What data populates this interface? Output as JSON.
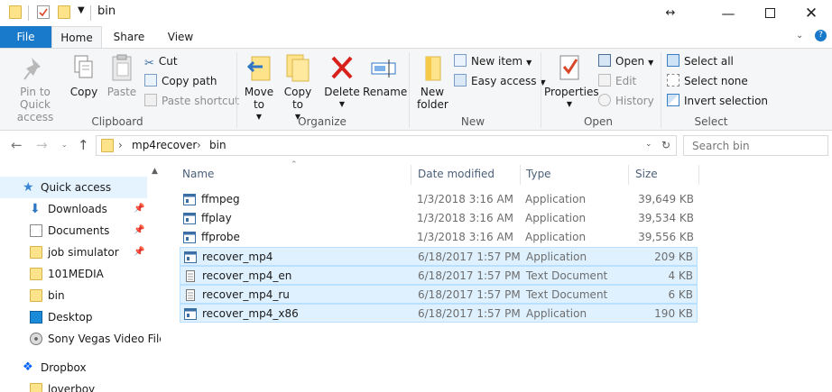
{
  "window": {
    "title": "bin"
  },
  "tabs": [
    "File",
    "Home",
    "Share",
    "View"
  ],
  "ribbon": {
    "clipboard": {
      "label": "Clipboard",
      "pin_to_quick_access": "Pin to Quick access",
      "copy": "Copy",
      "paste": "Paste",
      "cut": "Cut",
      "copy_path": "Copy path",
      "paste_shortcut": "Paste shortcut"
    },
    "organize": {
      "label": "Organize",
      "move_to": "Move to",
      "copy_to": "Copy to",
      "delete": "Delete",
      "rename": "Rename"
    },
    "new": {
      "label": "New",
      "new_folder": "New folder",
      "new_item": "New item",
      "easy_access": "Easy access"
    },
    "open": {
      "label": "Open",
      "properties": "Properties",
      "open": "Open",
      "edit": "Edit",
      "history": "History"
    },
    "select": {
      "label": "Select",
      "select_all": "Select all",
      "select_none": "Select none",
      "invert_selection": "Invert selection"
    }
  },
  "address": {
    "crumbs": [
      "mp4recover",
      "bin"
    ],
    "search_placeholder": "Search bin"
  },
  "nav_pane": [
    {
      "label": "Quick access",
      "icon": "star-icon",
      "selected": true
    },
    {
      "label": "Downloads",
      "icon": "download-icon",
      "pinned": true
    },
    {
      "label": "Documents",
      "icon": "documents-icon",
      "pinned": true
    },
    {
      "label": "job simulator",
      "icon": "folder-icon",
      "pinned": true
    },
    {
      "label": "101MEDIA",
      "icon": "folder-icon"
    },
    {
      "label": "bin",
      "icon": "folder-icon"
    },
    {
      "label": "Desktop",
      "icon": "desktop-icon"
    },
    {
      "label": "Sony Vegas Video File",
      "icon": "disc-icon"
    },
    {
      "label": "Dropbox",
      "icon": "dropbox-icon"
    },
    {
      "label": "loverboy",
      "icon": "folder-icon"
    }
  ],
  "columns": {
    "name": "Name",
    "date": "Date modified",
    "type": "Type",
    "size": "Size"
  },
  "files": [
    {
      "name": "ffmpeg",
      "date": "1/3/2018 3:16 AM",
      "type": "Application",
      "size": "39,649 KB",
      "icon": "application-icon"
    },
    {
      "name": "ffplay",
      "date": "1/3/2018 3:16 AM",
      "type": "Application",
      "size": "39,534 KB",
      "icon": "application-icon"
    },
    {
      "name": "ffprobe",
      "date": "1/3/2018 3:16 AM",
      "type": "Application",
      "size": "39,556 KB",
      "icon": "application-icon"
    },
    {
      "name": "recover_mp4",
      "date": "6/18/2017 1:57 PM",
      "type": "Application",
      "size": "209 KB",
      "icon": "application-icon"
    },
    {
      "name": "recover_mp4_en",
      "date": "6/18/2017 1:57 PM",
      "type": "Text Document",
      "size": "4 KB",
      "icon": "text-document-icon"
    },
    {
      "name": "recover_mp4_ru",
      "date": "6/18/2017 1:57 PM",
      "type": "Text Document",
      "size": "6 KB",
      "icon": "text-document-icon"
    },
    {
      "name": "recover_mp4_x86",
      "date": "6/18/2017 1:57 PM",
      "type": "Application",
      "size": "190 KB",
      "icon": "application-icon"
    }
  ]
}
